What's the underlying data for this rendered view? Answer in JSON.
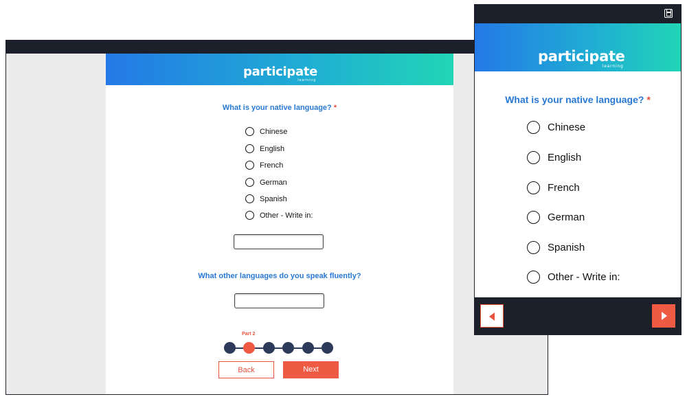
{
  "brand": {
    "logo_text": "participate",
    "logo_sub": "learning",
    "gradient_start": "#2479e6",
    "gradient_end": "#22d5b5",
    "accent": "#ef5a45",
    "question_color": "#2878d4",
    "chrome_color": "#1b202a"
  },
  "desktop": {
    "question1": {
      "text": "What is your native language?",
      "required_mark": "*",
      "options": [
        "Chinese",
        "English",
        "French",
        "German",
        "Spanish",
        "Other - Write in:"
      ]
    },
    "write_in_value": "",
    "question2": {
      "text": "What other languages do you speak fluently?"
    },
    "answer2_value": "",
    "progress": {
      "current_label": "Part 2",
      "steps": 6,
      "current_step": 2
    },
    "back_label": "Back",
    "next_label": "Next"
  },
  "mobile": {
    "save_icon": "save-icon",
    "question1": {
      "text": "What is your native language?",
      "required_mark": "*",
      "options": [
        "Chinese",
        "English",
        "French",
        "German",
        "Spanish",
        "Other - Write in:"
      ]
    },
    "prev_icon": "chevron-left-icon",
    "next_icon": "chevron-right-icon"
  }
}
